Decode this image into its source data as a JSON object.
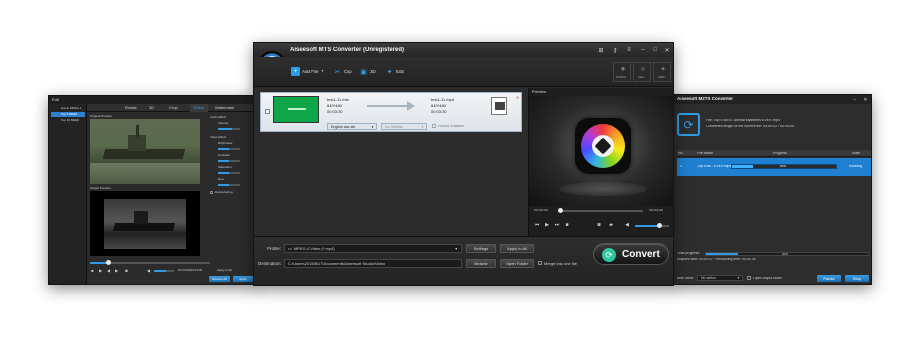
{
  "edit_window": {
    "title": "Edit",
    "sidebar_items": [
      "Game MPEG-1",
      "Top 5 BEER",
      "Top 10 BEER"
    ],
    "tabs": [
      "Rotate",
      "3D",
      "Crop",
      "Effect",
      "Watermark"
    ],
    "original_preview_label": "Original Preview",
    "output_preview_label": "Output Preview",
    "audio_effect_label": "Audio Effect",
    "volume_label": "Volume:",
    "video_effect_label": "Video Effect",
    "brightness_label": "Brightness:",
    "contrast_label": "Contrast:",
    "saturation_label": "Saturation:",
    "hue_label": "Hue:",
    "deinterlacing_label": "Deinterlacing",
    "time_display": "00:00:00/00:03:30",
    "apply_to_all_label": "Apply to All",
    "restore_all_label": "Restore All",
    "apply_label": "Apply",
    "close_label": "Close"
  },
  "main_window": {
    "title": "Aiseesoft MTS Converter (Unregistered)",
    "toolbar": {
      "add_file": "Add File",
      "clip": "Clip",
      "3d": "3D",
      "edit": "Edit",
      "nvidia": "NVIDIA",
      "intel": "Intel",
      "amd": "AMD"
    },
    "file": {
      "source_name": "test1-11.mts",
      "source_resolution": "640*480",
      "source_duration": "00:03:30",
      "output_name": "test1-11.mp4",
      "output_resolution": "640*480",
      "output_duration": "00:03:30",
      "audio_track": "English aac ste",
      "subtitle": "No Subtitle",
      "forced_subtitles": "Forced Subtitles"
    },
    "preview_label": "Preview",
    "preview_time_start": "00:00:00",
    "preview_time_end": "00:03:30",
    "profile_label": "Profile:",
    "profile_value": "MPEG-4 Video (*.mp4)",
    "settings_label": "Settings",
    "apply_to_all_label": "Apply to All",
    "destination_label": "Destination:",
    "destination_value": "C:\\Users\\20150617\\Documents\\Aiseesoft Studio\\Video",
    "browse_label": "Browse",
    "open_folder_label": "Open Folder",
    "merge_label": "Merge into one file",
    "convert_label": "Convert"
  },
  "progress_window": {
    "title": "Aiseesoft M2TS Converter",
    "file_line": "File: Top 5 BEST Animal Mysteries EVER.mp4",
    "converted_line": "Converted length of the current file: 00:00:02 / 00:05:00",
    "columns": [
      "No.",
      "File Name",
      "Progress",
      "State"
    ],
    "row": {
      "no": "1",
      "name": "Top 5 BE...EVER.mp4",
      "percent": "20%",
      "state": "Running",
      "progress": 0.2
    },
    "total_progress_label": "Total progress:",
    "total_percent": "20%",
    "total_progress": 0.2,
    "elapsed_line": "Elapsed time: 00:00:37 / Remaining time: 00:01:44",
    "after_done_label": "After done:",
    "after_done_value": "No action",
    "open_output_label": "Open output folder",
    "pause_label": "Pause",
    "stop_label": "Stop"
  },
  "colors": {
    "accent_blue": "#2f9be6",
    "highlight_row": "#1f7fd0",
    "window_bg": "#2b2b2b",
    "convert_green": "#2cc6a0"
  }
}
